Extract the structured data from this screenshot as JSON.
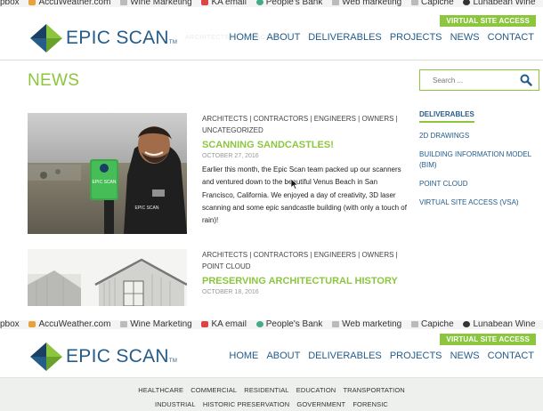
{
  "bookmarks": [
    {
      "label": "pbox",
      "icon": "none"
    },
    {
      "label": "AccuWeather.com",
      "icon": "weather-icon"
    },
    {
      "label": "Wine Marketing",
      "icon": "folder-icon"
    },
    {
      "label": "KA email",
      "icon": "email-icon"
    },
    {
      "label": "People's Bank",
      "icon": "google-icon"
    },
    {
      "label": "Web marketing",
      "icon": "folder-icon"
    },
    {
      "label": "Capiche",
      "icon": "folder-icon"
    },
    {
      "label": "Lunabean Wine",
      "icon": "wine-icon"
    }
  ],
  "header": {
    "brand": "EPIC SCAN",
    "trademark": "TM",
    "virtual_site_access": "VIRTUAL SITE ACCESS",
    "nav": [
      "HOME",
      "ABOUT",
      "DELIVERABLES",
      "PROJECTS",
      "NEWS",
      "CONTACT"
    ],
    "ghost_text": "ARCHITECTS   CONTRACTORS"
  },
  "page": {
    "title": "NEWS"
  },
  "posts": [
    {
      "categories": "ARCHITECTS | CONTRACTORS | ENGINEERS | OWNERS | UNCATEGORIZED",
      "title": "SCANNING SANDCASTLES!",
      "date": "OCTOBER 27, 2016",
      "excerpt": "Earlier this month, the Epic Scan team packed up our scanners and ventured down to the beautiful Venus Beach in San Francisco, California. We enjoyed a day of creativity, 3D laser scanning and some epic sandcastle building (with only a touch of rain)!",
      "scanner_label": "EPIC SCAN",
      "shirt_label": "EPIC SCAN"
    },
    {
      "categories": "ARCHITECTS | CONTRACTORS | ENGINEERS | OWNERS | POINT CLOUD",
      "title": "PRESERVING ARCHITECTURAL HISTORY",
      "date": "OCTOBER 18, 2016"
    }
  ],
  "search": {
    "placeholder": "Search ..."
  },
  "sidebar": {
    "heading": "DELIVERABLES",
    "items": [
      "2D DRAWINGS",
      "BUILDING INFORMATION MODEL (BIM)",
      "POINT CLOUD",
      "VIRTUAL SITE ACCESS (VSA)"
    ]
  },
  "subnav": {
    "row1": [
      "HEALTHCARE",
      "COMMERCIAL",
      "RESIDENTIAL",
      "EDUCATION",
      "TRANSPORTATION"
    ],
    "row2": [
      "INDUSTRIAL",
      "HISTORIC PRESERVATION",
      "GOVERNMENT",
      "FORENSIC"
    ]
  },
  "colors": {
    "green": "#8cc63f",
    "blue": "#245c8a",
    "dark_blue": "#1a3f63"
  }
}
